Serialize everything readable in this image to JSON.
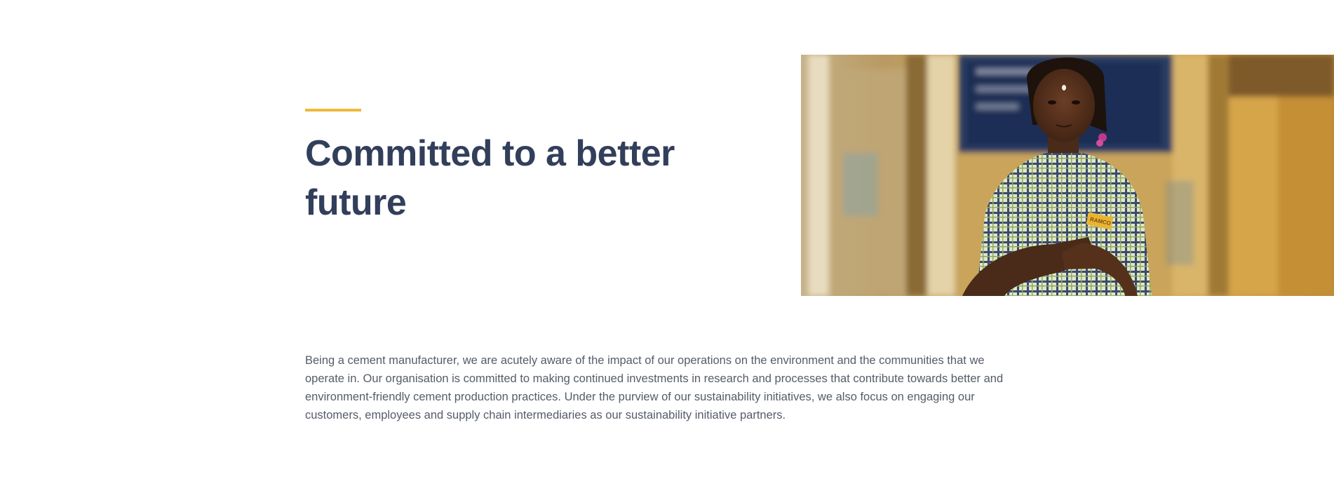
{
  "section": {
    "headline": "Committed to a better future",
    "body": "Being a cement manufacturer, we are acutely aware of the impact of our operations on the environment and the communities that we operate in. Our organisation is committed to making continued investments in research and processes that contribute towards better and environment-friendly cement production practices. Under the purview of our sustainability initiatives, we also focus on engaging our customers, employees and supply chain intermediaries as our sustainability initiative partners.",
    "accent_color": "#f0b93a",
    "headline_color": "#323f5b",
    "body_color": "#555c68"
  },
  "hero_image": {
    "description_icon": "photo-icon",
    "badge_text": "RAMCO"
  }
}
